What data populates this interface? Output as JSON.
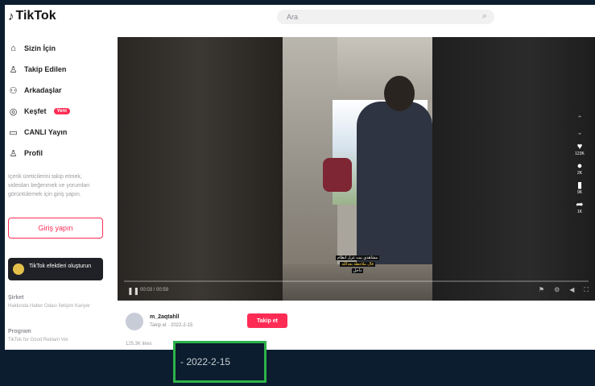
{
  "header": {
    "logo_text": "TikTok",
    "search_placeholder": "Ara",
    "icons": [
      "tiktok-note-icon",
      "search-icon"
    ]
  },
  "sidebar": {
    "items": [
      {
        "label": "Sizin İçin",
        "icon": "home-icon"
      },
      {
        "label": "Takip Edilen",
        "icon": "following-icon"
      },
      {
        "label": "Arkadaşlar",
        "icon": "friends-icon"
      },
      {
        "label": "Keşfet",
        "icon": "explore-icon",
        "badge": "Yeni"
      },
      {
        "label": "CANLI Yayın",
        "icon": "live-icon"
      },
      {
        "label": "Profil",
        "icon": "profile-icon"
      }
    ],
    "login_hint": "Içerik üreticilerini takip etmek, videoları beğenmek ve yorumları görüntülemek için giriş yapın.",
    "login_button": "Giriş yapın",
    "effects_banner": "TikTok efektleri oluşturun",
    "footer": [
      {
        "heading": "Şirket",
        "text": "Hakkında Haber Odası İletişim Kariyer"
      },
      {
        "heading": "Program",
        "text": "TikTok for Good Reklam Ver"
      }
    ]
  },
  "player": {
    "caption_lines": [
      "مشاهدي بيت غزل انظام",
      "قال ملاحظة بعدالله"
    ],
    "caption_sub": "داخل",
    "time": "00:03 / 00:59",
    "actions": [
      {
        "icon": "heart-icon",
        "count": "123K"
      },
      {
        "icon": "comment-icon",
        "count": "2K"
      },
      {
        "icon": "bookmark-icon",
        "count": "9K"
      },
      {
        "icon": "share-icon",
        "count": "1K"
      }
    ]
  },
  "author": {
    "username": "m_2aqtahll",
    "meta": "Takip et · 2022-2-15",
    "follow_button": "Takip et",
    "stats": "125.3K likes"
  },
  "highlight": {
    "date_text": "- 2022-2-15",
    "border_color": "#2db34a"
  }
}
